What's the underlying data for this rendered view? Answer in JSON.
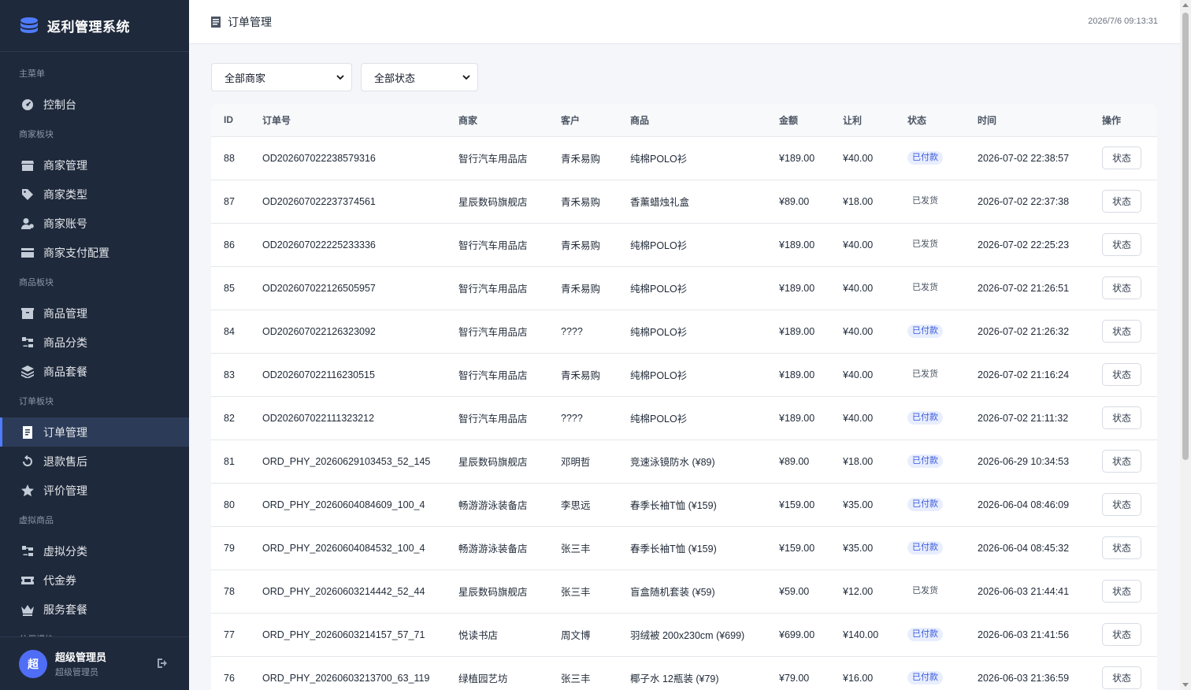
{
  "app": {
    "title": "返利管理系统"
  },
  "header": {
    "page_title": "订单管理",
    "datetime": "2026/7/6 09:13:31"
  },
  "sidebar": {
    "sections": [
      {
        "label": "主菜单",
        "items": [
          {
            "label": "控制台",
            "icon": "dashboard-icon"
          }
        ]
      },
      {
        "label": "商家板块",
        "items": [
          {
            "label": "商家管理",
            "icon": "store-icon"
          },
          {
            "label": "商家类型",
            "icon": "tags-icon"
          },
          {
            "label": "商家账号",
            "icon": "user-gear-icon"
          },
          {
            "label": "商家支付配置",
            "icon": "credit-card-icon"
          }
        ]
      },
      {
        "label": "商品板块",
        "items": [
          {
            "label": "商品管理",
            "icon": "box-icon"
          },
          {
            "label": "商品分类",
            "icon": "sitemap-icon"
          },
          {
            "label": "商品套餐",
            "icon": "layers-icon"
          }
        ]
      },
      {
        "label": "订单板块",
        "items": [
          {
            "label": "订单管理",
            "icon": "receipt-icon",
            "active": true
          },
          {
            "label": "退款售后",
            "icon": "undo-icon"
          },
          {
            "label": "评价管理",
            "icon": "star-icon"
          }
        ]
      },
      {
        "label": "虚拟商品",
        "items": [
          {
            "label": "虚拟分类",
            "icon": "sitemap-icon"
          },
          {
            "label": "代金券",
            "icon": "ticket-icon"
          },
          {
            "label": "服务套餐",
            "icon": "crown-icon"
          }
        ]
      },
      {
        "label": "分佣模块",
        "items": []
      }
    ]
  },
  "user": {
    "avatar_text": "超",
    "name": "超级管理员",
    "role": "超级管理员"
  },
  "filters": {
    "merchant": "全部商家",
    "status": "全部状态"
  },
  "table": {
    "columns": [
      "ID",
      "订单号",
      "商家",
      "客户",
      "商品",
      "金额",
      "让利",
      "状态",
      "时间",
      "操作"
    ],
    "action_label": "状态",
    "rows": [
      {
        "id": "88",
        "order_no": "OD202607022238579316",
        "merchant": "智行汽车用品店",
        "customer": "青禾易购",
        "product": "纯棉POLO衫",
        "amount": "¥189.00",
        "rebate": "¥40.00",
        "status": "已付款",
        "status_type": "paid",
        "time": "2026-07-02 22:38:57"
      },
      {
        "id": "87",
        "order_no": "OD202607022237374561",
        "merchant": "星辰数码旗舰店",
        "customer": "青禾易购",
        "product": "香薰蜡烛礼盒",
        "amount": "¥89.00",
        "rebate": "¥18.00",
        "status": "已发货",
        "status_type": "shipped",
        "time": "2026-07-02 22:37:38"
      },
      {
        "id": "86",
        "order_no": "OD202607022225233336",
        "merchant": "智行汽车用品店",
        "customer": "青禾易购",
        "product": "纯棉POLO衫",
        "amount": "¥189.00",
        "rebate": "¥40.00",
        "status": "已发货",
        "status_type": "shipped",
        "time": "2026-07-02 22:25:23"
      },
      {
        "id": "85",
        "order_no": "OD202607022126505957",
        "merchant": "智行汽车用品店",
        "customer": "青禾易购",
        "product": "纯棉POLO衫",
        "amount": "¥189.00",
        "rebate": "¥40.00",
        "status": "已发货",
        "status_type": "shipped",
        "time": "2026-07-02 21:26:51"
      },
      {
        "id": "84",
        "order_no": "OD202607022126323092",
        "merchant": "智行汽车用品店",
        "customer": "????",
        "product": "纯棉POLO衫",
        "amount": "¥189.00",
        "rebate": "¥40.00",
        "status": "已付款",
        "status_type": "paid",
        "time": "2026-07-02 21:26:32"
      },
      {
        "id": "83",
        "order_no": "OD202607022116230515",
        "merchant": "智行汽车用品店",
        "customer": "青禾易购",
        "product": "纯棉POLO衫",
        "amount": "¥189.00",
        "rebate": "¥40.00",
        "status": "已发货",
        "status_type": "shipped",
        "time": "2026-07-02 21:16:24"
      },
      {
        "id": "82",
        "order_no": "OD202607022111323212",
        "merchant": "智行汽车用品店",
        "customer": "????",
        "product": "纯棉POLO衫",
        "amount": "¥189.00",
        "rebate": "¥40.00",
        "status": "已付款",
        "status_type": "paid",
        "time": "2026-07-02 21:11:32"
      },
      {
        "id": "81",
        "order_no": "ORD_PHY_20260629103453_52_145",
        "merchant": "星辰数码旗舰店",
        "customer": "邓明哲",
        "product": "竞速泳镜防水 (¥89)",
        "amount": "¥89.00",
        "rebate": "¥18.00",
        "status": "已付款",
        "status_type": "paid",
        "time": "2026-06-29 10:34:53"
      },
      {
        "id": "80",
        "order_no": "ORD_PHY_20260604084609_100_4",
        "merchant": "畅游游泳装备店",
        "customer": "李思远",
        "product": "春季长袖T恤 (¥159)",
        "amount": "¥159.00",
        "rebate": "¥35.00",
        "status": "已付款",
        "status_type": "paid",
        "time": "2026-06-04 08:46:09"
      },
      {
        "id": "79",
        "order_no": "ORD_PHY_20260604084532_100_4",
        "merchant": "畅游游泳装备店",
        "customer": "张三丰",
        "product": "春季长袖T恤 (¥159)",
        "amount": "¥159.00",
        "rebate": "¥35.00",
        "status": "已付款",
        "status_type": "paid",
        "time": "2026-06-04 08:45:32"
      },
      {
        "id": "78",
        "order_no": "ORD_PHY_20260603214442_52_44",
        "merchant": "星辰数码旗舰店",
        "customer": "张三丰",
        "product": "盲盒随机套装 (¥59)",
        "amount": "¥59.00",
        "rebate": "¥12.00",
        "status": "已发货",
        "status_type": "shipped",
        "time": "2026-06-03 21:44:41"
      },
      {
        "id": "77",
        "order_no": "ORD_PHY_20260603214157_57_71",
        "merchant": "悦读书店",
        "customer": "周文博",
        "product": "羽绒被 200x230cm (¥699)",
        "amount": "¥699.00",
        "rebate": "¥140.00",
        "status": "已付款",
        "status_type": "paid",
        "time": "2026-06-03 21:41:56"
      },
      {
        "id": "76",
        "order_no": "ORD_PHY_20260603213700_63_119",
        "merchant": "绿植园艺坊",
        "customer": "张三丰",
        "product": "椰子水 12瓶装 (¥79)",
        "amount": "¥79.00",
        "rebate": "¥16.00",
        "status": "已付款",
        "status_type": "paid",
        "time": "2026-06-03 21:36:59"
      }
    ]
  },
  "colors": {
    "sidebar_bg": "#1e293b",
    "accent": "#4f7cff",
    "badge_paid_bg": "#e8eefe",
    "badge_paid_text": "#3b5bdb"
  }
}
